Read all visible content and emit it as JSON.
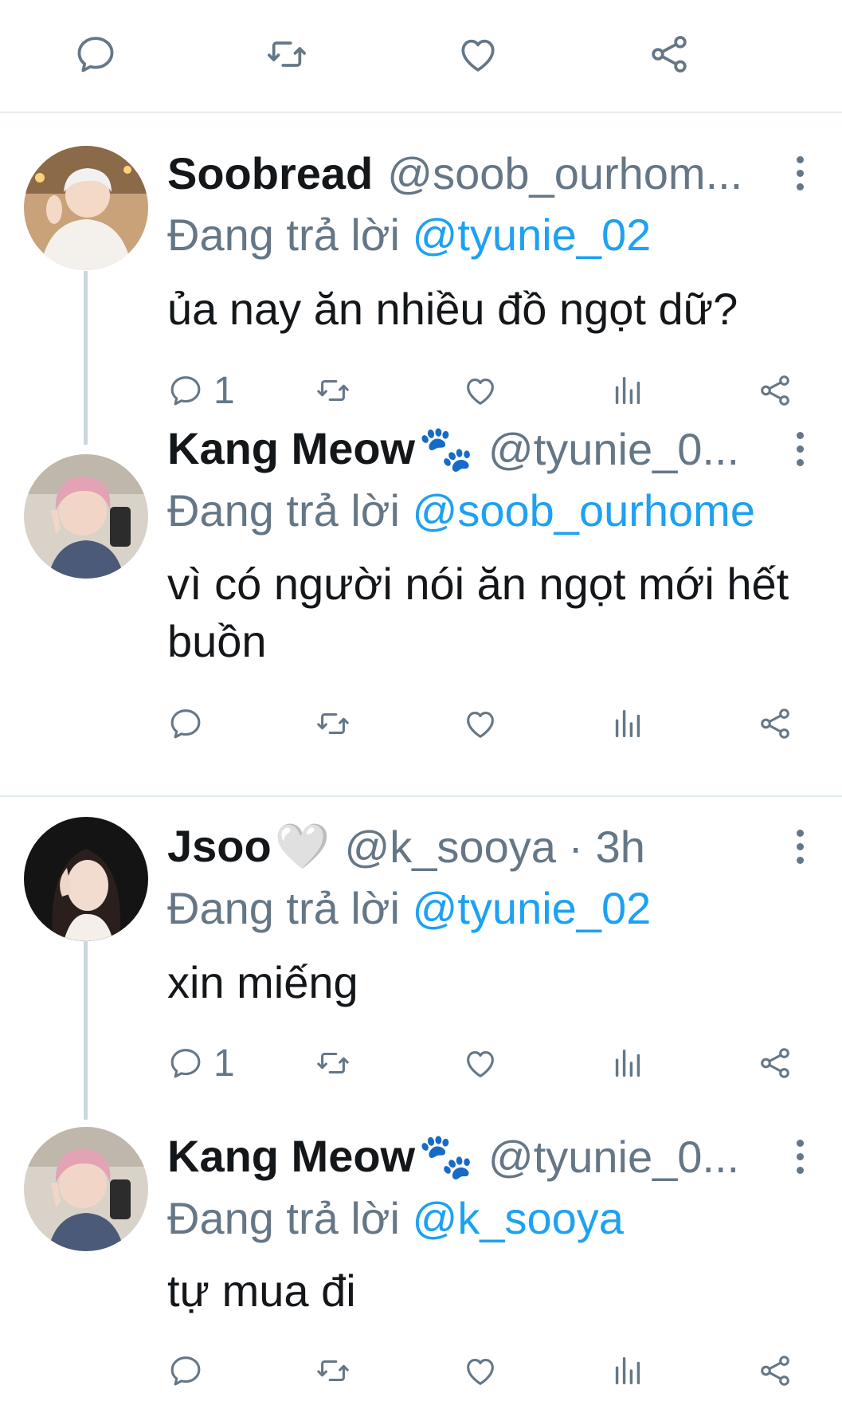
{
  "colors": {
    "accent": "#1da1f2",
    "secondary_text": "#657786",
    "thread_line": "#ccd6dd",
    "divider": "#e6ecf0"
  },
  "top_actions": {
    "icons": [
      "reply-icon",
      "retweet-icon",
      "like-icon",
      "share-icon"
    ]
  },
  "tweets": [
    {
      "name": "Soobread",
      "name_emoji": "",
      "handle": "@soob_ourhom...",
      "reply_prefix": "Đang trả lời",
      "reply_to": "@tyunie_02",
      "text": "ủa nay ăn nhiều đồ ngọt dữ?",
      "reply_count": "1",
      "avatar": "person-white-hoodie"
    },
    {
      "name": "Kang Meow",
      "name_emoji": "🐾",
      "handle": "@tyunie_0...",
      "reply_prefix": "Đang trả lời",
      "reply_to": "@soob_ourhome",
      "text": "vì có người nói ăn ngọt mới hết buồn",
      "reply_count": "",
      "avatar": "person-pink-hair-selfie"
    },
    {
      "name": "Jsoo",
      "name_emoji": "🤍",
      "handle": "@k_sooya · 3h",
      "reply_prefix": "Đang trả lời",
      "reply_to": "@tyunie_02",
      "text": "xin miếng",
      "reply_count": "1",
      "avatar": "person-dark-hair"
    },
    {
      "name": "Kang Meow",
      "name_emoji": "🐾",
      "handle": "@tyunie_0...",
      "reply_prefix": "Đang trả lời",
      "reply_to": "@k_sooya",
      "text": "tự mua đi",
      "reply_count": "",
      "avatar": "person-pink-hair-selfie"
    }
  ],
  "action_icons": [
    "reply-icon",
    "retweet-icon",
    "like-icon",
    "analytics-icon",
    "share-icon"
  ]
}
